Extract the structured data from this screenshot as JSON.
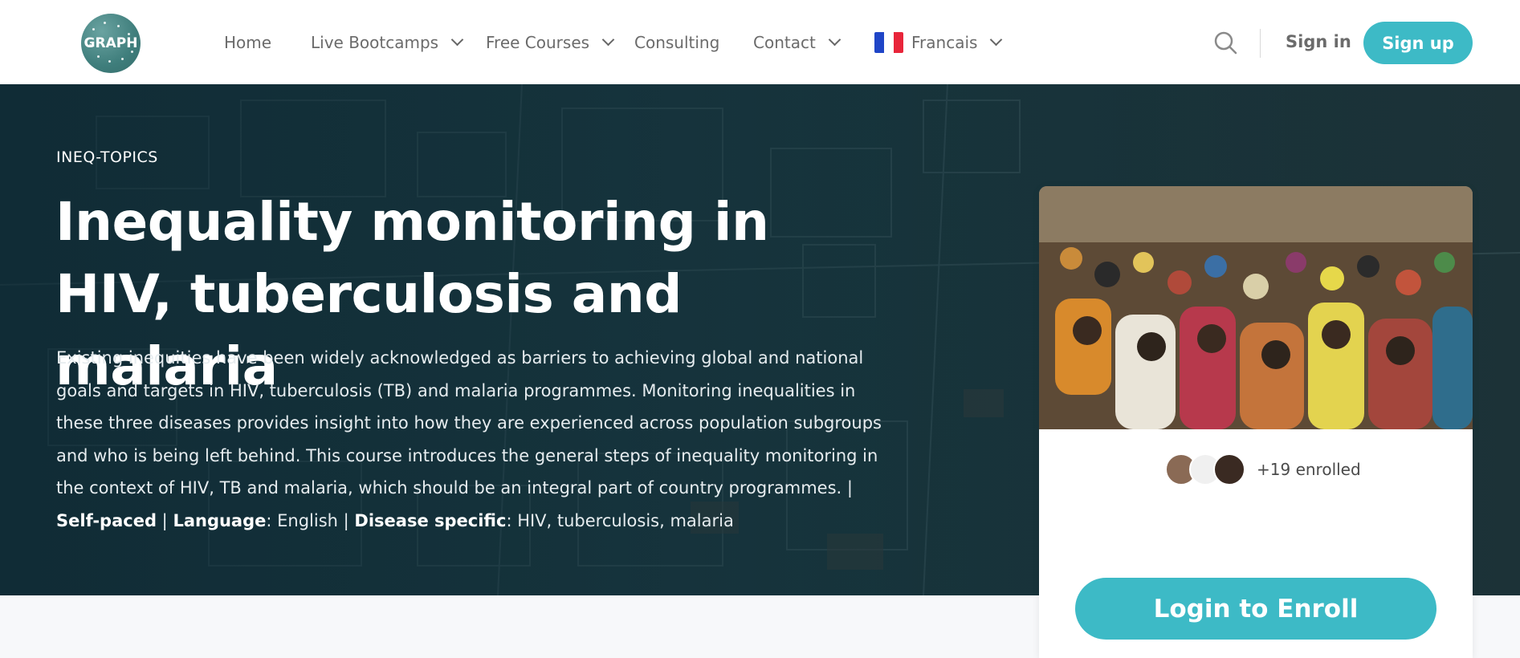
{
  "brand": {
    "logo_text": "GRAPH"
  },
  "nav": {
    "home": "Home",
    "live_bootcamps": "Live Bootcamps",
    "free_courses": "Free Courses",
    "consulting": "Consulting",
    "contact": "Contact",
    "language": "Francais"
  },
  "auth": {
    "sign_in": "Sign in",
    "sign_up": "Sign up"
  },
  "hero": {
    "topic": "INEQ-TOPICS",
    "title": "Inequality monitoring in HIV, tuberculosis and malaria",
    "description": "Existing inequities have been widely acknowledged as barriers to achieving global and national goals and targets in HIV, tuberculosis (TB) and malaria programmes. Monitoring inequalities in these three diseases provides insight into how they are experienced across population subgroups and who is being left behind. This course introduces the general steps of inequality monitoring in the context of HIV, TB and malaria, which should be an integral part of country programmes. |",
    "label_self_paced": "Self-paced",
    "sep": "|",
    "label_language": "Language",
    "language_value": ": English |",
    "label_disease": "Disease specific",
    "disease_value": ": HIV, tuberculosis, malaria"
  },
  "card": {
    "enrolled_text": "+19 enrolled",
    "enroll_button": "Login to Enroll"
  },
  "colors": {
    "accent": "#3dbac6",
    "header_bg": "#ffffff",
    "hero_bg": "#1d3d47"
  },
  "icons": {
    "search": "search-icon",
    "flag": "france-flag-icon",
    "dropdown": "chevron-down-icon"
  }
}
